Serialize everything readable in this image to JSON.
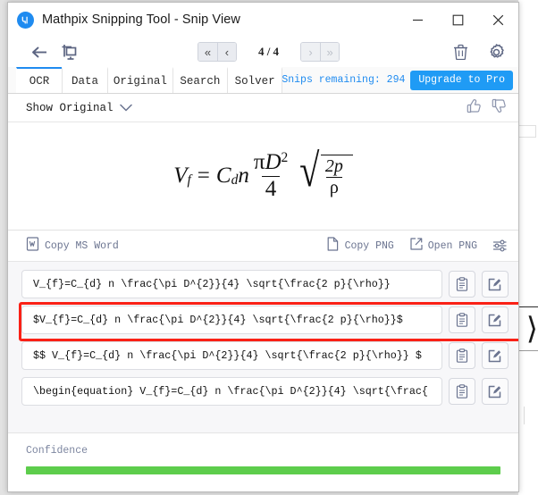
{
  "window": {
    "title": "Mathpix Snipping Tool - Snip View",
    "logo_icon": "mathpix-logo-icon",
    "minimize_label": "—",
    "maximize_label": "☐",
    "close_label": "✕"
  },
  "toolbar": {
    "back_icon": "back-arrow-icon",
    "snip_icon": "new-snip-icon",
    "first_label": "«",
    "prev_label": "‹",
    "next_label": "›",
    "last_label": "»",
    "page_indicator": "4 / 4",
    "delete_icon": "trash-icon",
    "settings_icon": "gear-icon"
  },
  "tabs": [
    {
      "label": "OCR",
      "active": true
    },
    {
      "label": "Data",
      "active": false
    },
    {
      "label": "Original",
      "active": false
    },
    {
      "label": "Search",
      "active": false
    },
    {
      "label": "Solver",
      "active": false
    }
  ],
  "snips": {
    "remaining_text": "Snips remaining: 294",
    "upgrade_label": "Upgrade to Pro",
    "accent_color": "#1f9bf5"
  },
  "show_row": {
    "label": "Show Original",
    "chevron_icon": "chevron-down-icon",
    "thumbs_up_icon": "thumbs-up-icon",
    "thumbs_down_icon": "thumbs-down-icon"
  },
  "equation": {
    "latex": "V_{f}=C_{d} n \\frac{\\pi D^{2}}{4} \\sqrt{\\frac{2 p}{\\rho}}",
    "lhs_var": "V",
    "lhs_sub": "f",
    "equals": "=",
    "c_var": "C",
    "c_sub": "d",
    "n_var": "n",
    "frac_num_pi": "π",
    "frac_num_d": "D",
    "frac_num_exp": "2",
    "frac_den": "4",
    "sqrt_sign": "√",
    "sqrt_num": "2p",
    "sqrt_den": "ρ"
  },
  "copybar": {
    "copy_ms_word": "Copy MS Word",
    "word_icon": "ms-word-icon",
    "copy_png": "Copy PNG",
    "copy_png_icon": "copy-page-icon",
    "open_png": "Open PNG",
    "open_png_icon": "external-link-icon",
    "options_icon": "sliders-icon"
  },
  "results": [
    {
      "text": "V_{f}=C_{d} n \\frac{\\pi D^{2}}{4} \\sqrt{\\frac{2 p}{\\rho}}",
      "selected": false,
      "copy_icon": "clipboard-copy-icon",
      "edit_icon": "edit-pencil-icon"
    },
    {
      "text": "$V_{f}=C_{d} n \\frac{\\pi D^{2}}{4} \\sqrt{\\frac{2 p}{\\rho}}$",
      "selected": true,
      "copy_icon": "clipboard-copy-icon",
      "edit_icon": "edit-pencil-icon"
    },
    {
      "text": "$$  V_{f}=C_{d} n \\frac{\\pi D^{2}}{4} \\sqrt{\\frac{2 p}{\\rho}}  $",
      "selected": false,
      "copy_icon": "clipboard-copy-icon",
      "edit_icon": "edit-pencil-icon"
    },
    {
      "text": "\\begin{equation}  V_{f}=C_{d} n \\frac{\\pi D^{2}}{4} \\sqrt{\\frac{",
      "selected": false,
      "copy_icon": "clipboard-copy-icon",
      "edit_icon": "edit-pencil-icon"
    }
  ],
  "confidence": {
    "label": "Confidence",
    "percent": 100,
    "bar_color": "#5dcd4c"
  },
  "selection_highlight_color": "#fa2116"
}
